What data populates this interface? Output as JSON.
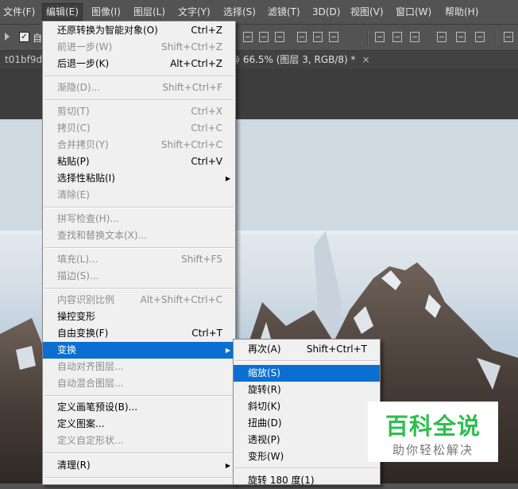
{
  "menubar": {
    "items": [
      "文件(F)",
      "编辑(E)",
      "图像(I)",
      "图层(L)",
      "文字(Y)",
      "选择(S)",
      "滤镜(T)",
      "3D(D)",
      "视图(V)",
      "窗口(W)",
      "帮助(H)"
    ],
    "active": "编辑(E)"
  },
  "tabs": {
    "first": "t01bf9d",
    "document": "@ 66.5% (图层 3, RGB/8) *",
    "close": "×"
  },
  "edit_menu": {
    "items": [
      {
        "label": "还原转换为智能对象(O)",
        "shortcut": "Ctrl+Z",
        "disabled": false
      },
      {
        "label": "前进一步(W)",
        "shortcut": "Shift+Ctrl+Z",
        "disabled": true
      },
      {
        "label": "后退一步(K)",
        "shortcut": "Alt+Ctrl+Z",
        "disabled": false
      },
      {
        "label": "渐隐(D)...",
        "shortcut": "Shift+Ctrl+F",
        "disabled": true
      },
      {
        "label": "剪切(T)",
        "shortcut": "Ctrl+X",
        "disabled": true
      },
      {
        "label": "拷贝(C)",
        "shortcut": "Ctrl+C",
        "disabled": true
      },
      {
        "label": "合并拷贝(Y)",
        "shortcut": "Shift+Ctrl+C",
        "disabled": true
      },
      {
        "label": "粘贴(P)",
        "shortcut": "Ctrl+V",
        "disabled": false
      },
      {
        "label": "选择性粘贴(I)",
        "shortcut": "",
        "disabled": false,
        "submenu": true
      },
      {
        "label": "清除(E)",
        "shortcut": "",
        "disabled": true
      },
      {
        "label": "拼写检查(H)...",
        "shortcut": "",
        "disabled": true
      },
      {
        "label": "查找和替换文本(X)...",
        "shortcut": "",
        "disabled": true
      },
      {
        "label": "填充(L)...",
        "shortcut": "Shift+F5",
        "disabled": true
      },
      {
        "label": "描边(S)...",
        "shortcut": "",
        "disabled": true
      },
      {
        "label": "内容识别比例",
        "shortcut": "Alt+Shift+Ctrl+C",
        "disabled": true
      },
      {
        "label": "操控变形",
        "shortcut": "",
        "disabled": false
      },
      {
        "label": "自由变换(F)",
        "shortcut": "Ctrl+T",
        "disabled": false
      },
      {
        "label": "变换",
        "shortcut": "",
        "disabled": false,
        "submenu": true,
        "highlighted": true
      },
      {
        "label": "自动对齐图层...",
        "shortcut": "",
        "disabled": true
      },
      {
        "label": "自动混合图层...",
        "shortcut": "",
        "disabled": true
      },
      {
        "label": "定义画笔预设(B)...",
        "shortcut": "",
        "disabled": false
      },
      {
        "label": "定义图案...",
        "shortcut": "",
        "disabled": false
      },
      {
        "label": "定义自定形状...",
        "shortcut": "",
        "disabled": true
      },
      {
        "label": "清理(R)",
        "shortcut": "",
        "disabled": false,
        "submenu": true
      }
    ]
  },
  "transform_submenu": {
    "items": [
      {
        "label": "再次(A)",
        "shortcut": "Shift+Ctrl+T",
        "highlighted": false
      },
      {
        "label": "缩放(S)",
        "shortcut": "",
        "highlighted": true
      },
      {
        "label": "旋转(R)",
        "shortcut": "",
        "highlighted": false
      },
      {
        "label": "斜切(K)",
        "shortcut": "",
        "highlighted": false
      },
      {
        "label": "扭曲(D)",
        "shortcut": "",
        "highlighted": false
      },
      {
        "label": "透视(P)",
        "shortcut": "",
        "highlighted": false
      },
      {
        "label": "变形(W)",
        "shortcut": "",
        "highlighted": false
      },
      {
        "label": "旋转 180 度(1)",
        "shortcut": "",
        "highlighted": false
      }
    ]
  },
  "icons": {
    "submenu_arrow": "▶",
    "checkbox": "checkbox-icon"
  },
  "option_bar": {
    "auto_select_label": "自"
  },
  "watermark": {
    "title": "百科全说",
    "subtitle": "助你轻松解决"
  },
  "colors": {
    "highlight": "#0a6fd1",
    "menu_bg": "#f0f0f0",
    "app_bg": "#535353",
    "watermark_green": "#2dbf4f"
  }
}
